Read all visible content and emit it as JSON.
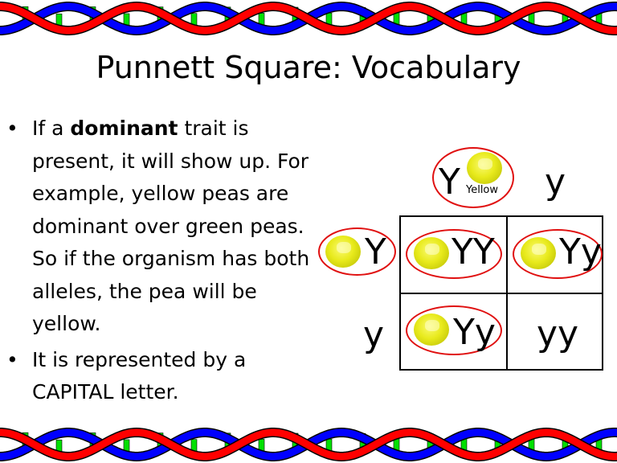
{
  "title": "Punnett Square: Vocabulary",
  "bullets": [
    {
      "pre": "If a ",
      "bold": "dominant",
      "post": " trait is present, it will show up. For example, yellow peas are dominant over green peas. So if the organism has both alleles, the pea will be yellow."
    },
    {
      "pre": "It is represented by a CAPITAL letter.",
      "bold": "",
      "post": ""
    }
  ],
  "bullet_glyph": "•",
  "punnett": {
    "top": [
      "Y",
      "y"
    ],
    "top_note": "Yellow",
    "left": [
      "Y",
      "y"
    ],
    "cells": [
      [
        "YY",
        "Yy"
      ],
      [
        "Yy",
        "yy"
      ]
    ]
  },
  "colors": {
    "strand_a": "#ff0000",
    "strand_b": "#0000ff",
    "rung": "#00e000",
    "circle": "#e01010",
    "pea": "#e8ea1c"
  }
}
